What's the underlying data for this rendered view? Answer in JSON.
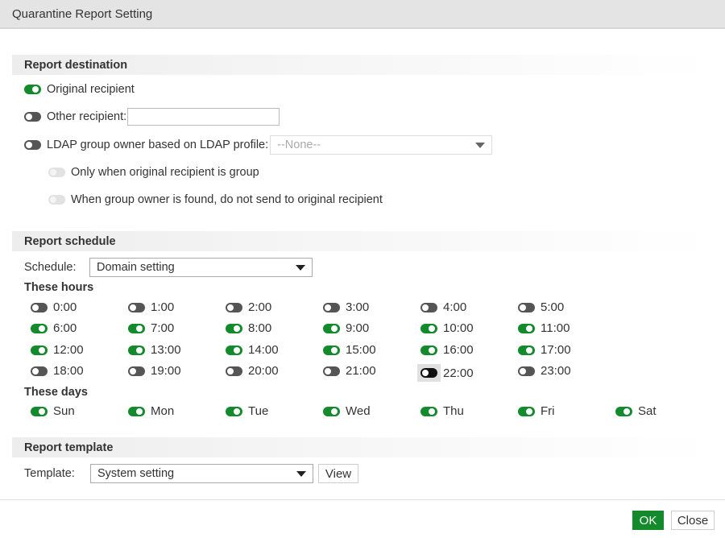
{
  "window": {
    "title": "Quarantine Report Setting"
  },
  "destination": {
    "heading": "Report destination",
    "original_recipient": {
      "label": "Original recipient",
      "enabled": true
    },
    "other_recipient": {
      "label": "Other recipient:",
      "enabled": false,
      "value": ""
    },
    "ldap_owner": {
      "label": "LDAP group owner based on LDAP profile:",
      "enabled": false,
      "profile": "--None--"
    },
    "only_when_group": {
      "label": "Only when original recipient is group",
      "enabled": false,
      "disabled": true
    },
    "do_not_send_original": {
      "label": "When group owner is found, do not send to original recipient",
      "enabled": false,
      "disabled": true
    }
  },
  "schedule": {
    "heading": "Report schedule",
    "schedule_label": "Schedule:",
    "schedule_value": "Domain setting",
    "hours_heading": "These hours",
    "hours": [
      {
        "label": "0:00",
        "on": false
      },
      {
        "label": "1:00",
        "on": false
      },
      {
        "label": "2:00",
        "on": false
      },
      {
        "label": "3:00",
        "on": false
      },
      {
        "label": "4:00",
        "on": false
      },
      {
        "label": "5:00",
        "on": false
      },
      {
        "label": "6:00",
        "on": true
      },
      {
        "label": "7:00",
        "on": true
      },
      {
        "label": "8:00",
        "on": true
      },
      {
        "label": "9:00",
        "on": true
      },
      {
        "label": "10:00",
        "on": true
      },
      {
        "label": "11:00",
        "on": true
      },
      {
        "label": "12:00",
        "on": true
      },
      {
        "label": "13:00",
        "on": true
      },
      {
        "label": "14:00",
        "on": true
      },
      {
        "label": "15:00",
        "on": true
      },
      {
        "label": "16:00",
        "on": true
      },
      {
        "label": "17:00",
        "on": true
      },
      {
        "label": "18:00",
        "on": false
      },
      {
        "label": "19:00",
        "on": false
      },
      {
        "label": "20:00",
        "on": false
      },
      {
        "label": "21:00",
        "on": false
      },
      {
        "label": "22:00",
        "on": false,
        "focused": true
      },
      {
        "label": "23:00",
        "on": false
      }
    ],
    "days_heading": "These days",
    "days": [
      {
        "label": "Sun",
        "on": true
      },
      {
        "label": "Mon",
        "on": true
      },
      {
        "label": "Tue",
        "on": true
      },
      {
        "label": "Wed",
        "on": true
      },
      {
        "label": "Thu",
        "on": true
      },
      {
        "label": "Fri",
        "on": true
      },
      {
        "label": "Sat",
        "on": true
      }
    ]
  },
  "template": {
    "heading": "Report template",
    "template_label": "Template:",
    "template_value": "System setting",
    "view_label": "View"
  },
  "footer": {
    "ok_label": "OK",
    "close_label": "Close"
  },
  "colors": {
    "accent": "#138a2c",
    "toggle_off": "#555555"
  }
}
